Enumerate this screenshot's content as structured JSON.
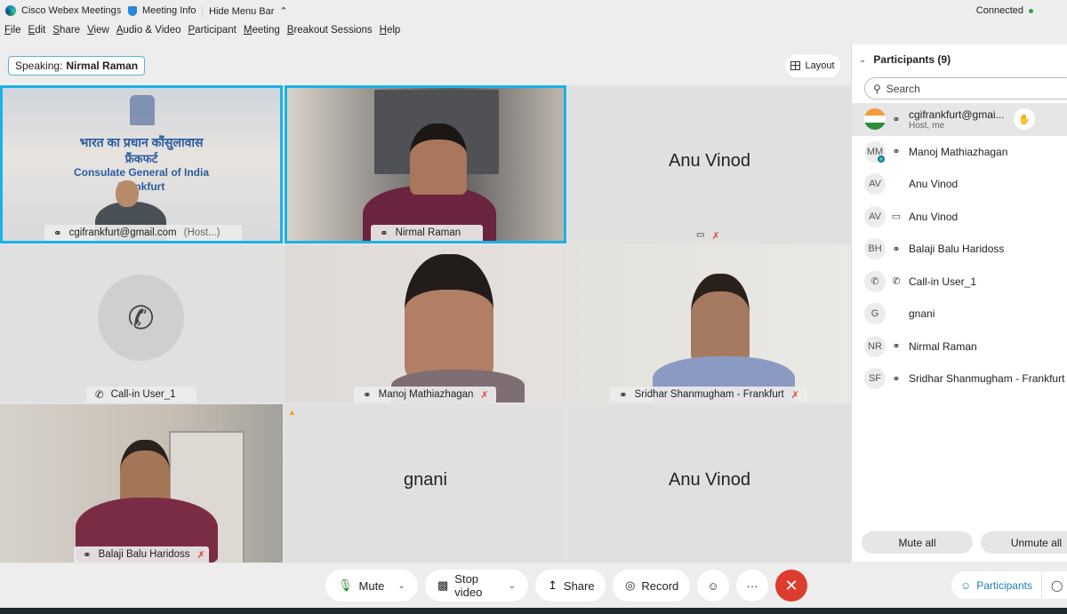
{
  "titlebar": {
    "app_name": "Cisco Webex Meetings",
    "meeting_info": "Meeting Info",
    "hide_menu_bar": "Hide Menu Bar",
    "connection_status": "Connected"
  },
  "menu": [
    "File",
    "Edit",
    "Share",
    "View",
    "Audio & Video",
    "Participant",
    "Meeting",
    "Breakout Sessions",
    "Help"
  ],
  "speaking": {
    "label": "Speaking:",
    "name": "Nirmal Raman"
  },
  "layout_button": "Layout",
  "tiles": [
    {
      "name": "cgifrankfurt@gmail.com",
      "suffix": "(Host...)",
      "video": true,
      "active": true,
      "banner_hindi": "भारत का प्रधान कौंसुलावास",
      "banner_hindi_city": "फ्रैंकफर्ट",
      "banner_en": "Consulate General of India",
      "banner_en_city": "Frankfurt"
    },
    {
      "name": "Nirmal Raman",
      "video": true,
      "active": true
    },
    {
      "name": "Anu Vinod",
      "video": false
    },
    {
      "name": "Call-in User_1",
      "video": false,
      "phone": true
    },
    {
      "name": "Manoj Mathiazhagan",
      "video": true,
      "muted": true
    },
    {
      "name": "Sridhar Shanmugham - Frankfurt",
      "video": true,
      "muted": true
    },
    {
      "name": "Balaji Balu Haridoss",
      "video": true,
      "muted": true
    },
    {
      "name": "gnani",
      "video": false,
      "warning": true
    },
    {
      "name": "Anu Vinod",
      "video": false
    }
  ],
  "participants_panel": {
    "title": "Participants (9)",
    "search_placeholder": "Search",
    "participants": [
      {
        "initials": "",
        "name": "cgifrankfurt@gmai...",
        "sub": "Host, me",
        "status": "headset"
      },
      {
        "initials": "MM",
        "name": "Manoj Mathiazhagan",
        "status": "headset"
      },
      {
        "initials": "AV",
        "name": "Anu Vinod",
        "status": ""
      },
      {
        "initials": "AV",
        "name": "Anu Vinod",
        "status": "device"
      },
      {
        "initials": "BH",
        "name": "Balaji Balu Haridoss",
        "status": "headset"
      },
      {
        "initials": "",
        "name": "Call-in User_1",
        "status": "phone"
      },
      {
        "initials": "G",
        "name": "gnani",
        "status": ""
      },
      {
        "initials": "NR",
        "name": "Nirmal Raman",
        "status": "headset"
      },
      {
        "initials": "SF",
        "name": "Sridhar Shanmugham - Frankfurt",
        "status": "headset"
      }
    ],
    "mute_all": "Mute all",
    "unmute_all": "Unmute all"
  },
  "toolbar": {
    "mute": "Mute",
    "stop_video": "Stop video",
    "share": "Share",
    "record": "Record"
  },
  "side_tabs": {
    "participants": "Participants"
  },
  "colors": {
    "accent": "#1ab2e6",
    "leave": "#dc3d2f",
    "muted": "#e04a3a",
    "link": "#1c7eb5"
  }
}
